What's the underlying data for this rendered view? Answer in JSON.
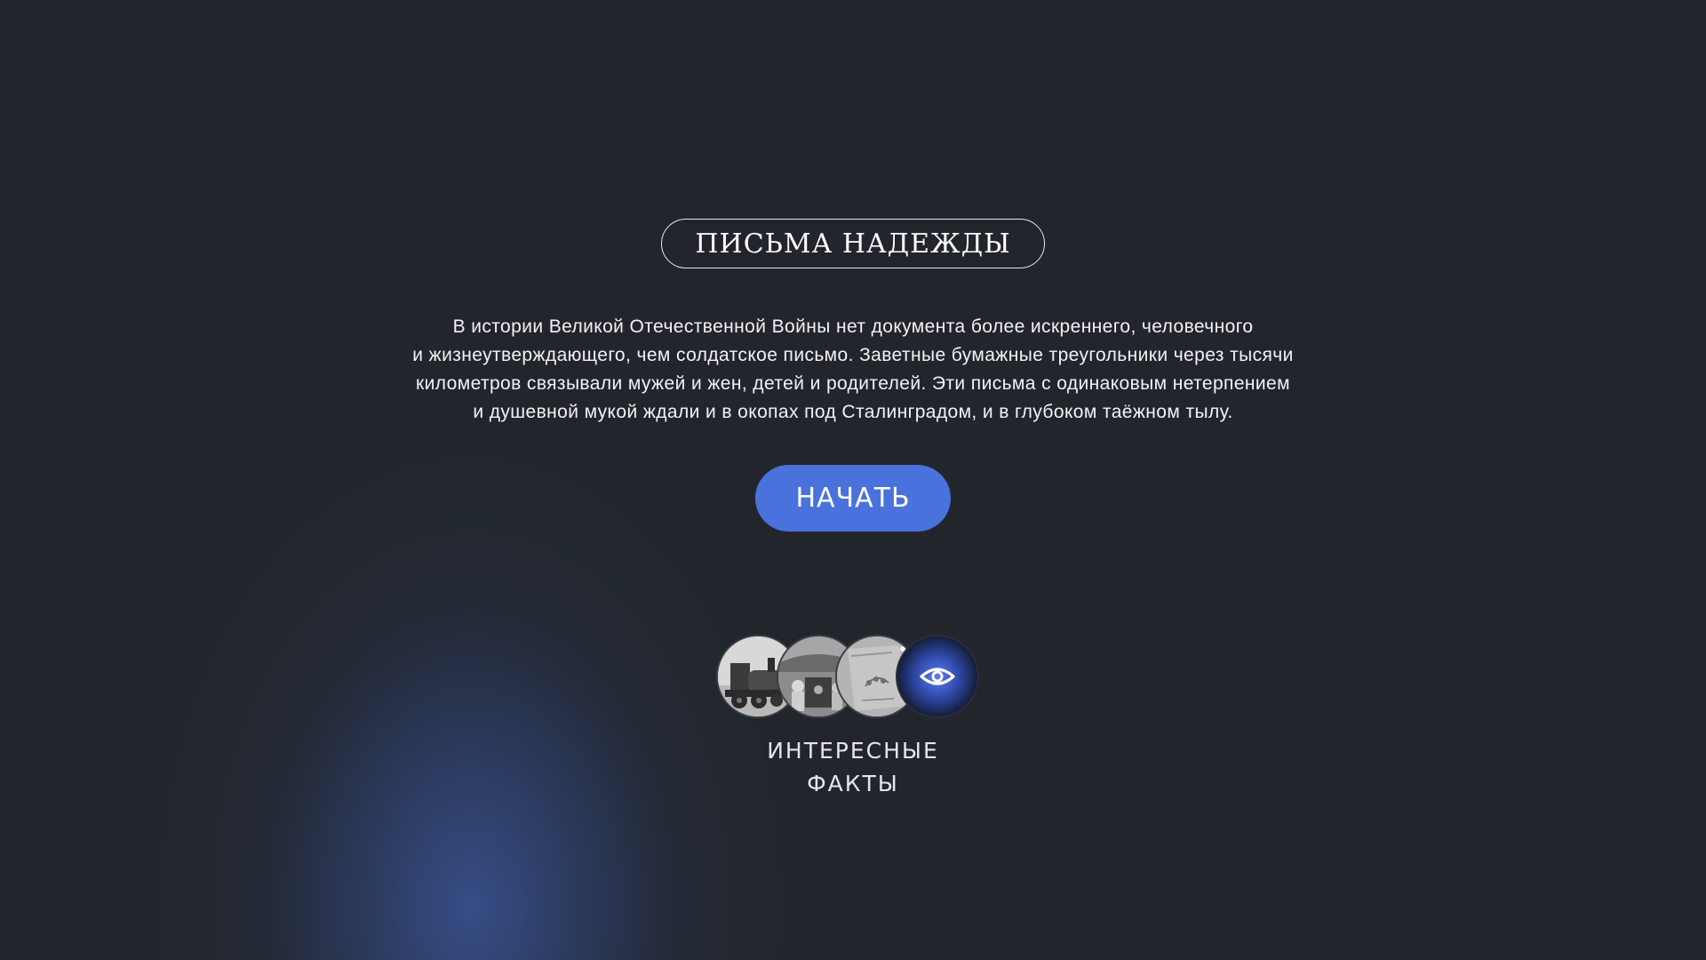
{
  "header": {
    "title": "ПИСЬМА НАДЕЖДЫ"
  },
  "intro": {
    "lines": [
      "В истории Великой Отечественной Войны нет документа более искреннего, человечного",
      "и жизнеутверждающего, чем солдатское письмо. Заветные бумажные треугольники через тысячи",
      "километров связывали мужей и жен, детей и родителей. Эти письма с одинаковым нетерпением",
      "и душевной мукой ждали и в окопах под Сталинградом, и в глубоком таёжном тылу."
    ]
  },
  "start_button": {
    "label": "НАЧАТЬ",
    "color": "#4a72dc"
  },
  "facts": {
    "thumbnails": [
      "steam-locomotive-photo",
      "soldiers-in-dugout-photo",
      "embroidered-pouch-photo"
    ],
    "icon": "eye-icon",
    "label_lines": [
      "ИНТЕРЕСНЫЕ",
      "ФАКТЫ"
    ]
  },
  "colors": {
    "background": "#22262c",
    "glow": "#3a5496"
  }
}
